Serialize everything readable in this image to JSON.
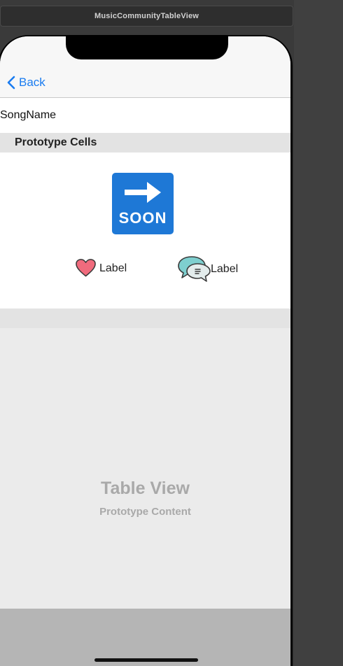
{
  "window": {
    "title": "MusicCommunityTableView"
  },
  "nav": {
    "back_label": "Back"
  },
  "header_cell": {
    "song_name": "SongName"
  },
  "section": {
    "title": "Prototype Cells"
  },
  "cell": {
    "image_label": "SOON",
    "like_label": "Label",
    "comment_label": "Label"
  },
  "placeholder": {
    "title": "Table View",
    "subtitle": "Prototype Content"
  },
  "colors": {
    "accent": "#1a7cf0",
    "soon_blue": "#1e78d6",
    "heart": "#f06b7d",
    "chat_teal": "#7ecfcf"
  },
  "icons": [
    "chevron-left-icon",
    "arrow-right-icon",
    "heart-icon",
    "chat-bubbles-icon"
  ]
}
